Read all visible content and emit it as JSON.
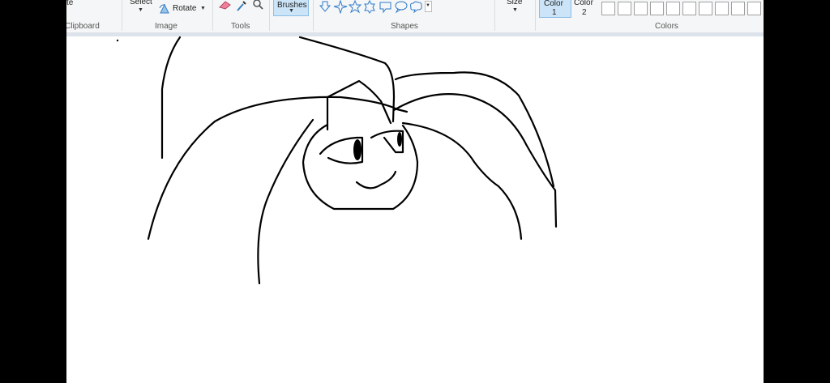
{
  "ribbon": {
    "paste_label": "te",
    "select_label": "Select",
    "rotate_label": "Rotate",
    "brushes_label": "Brushes",
    "size_label": "Size",
    "color1_label": "Color",
    "color1_num": "1",
    "color2_label": "Color",
    "color2_num": "2",
    "groups": {
      "clipboard": "Clipboard",
      "image": "Image",
      "tools": "Tools",
      "shapes": "Shapes",
      "colors": "Colors"
    }
  },
  "icons": [
    "eraser-icon",
    "color-picker-icon",
    "magnifier-icon",
    "rotate-icon",
    "arrow-down-shape-icon",
    "star-4-icon",
    "star-5-icon",
    "star-6-icon",
    "rect-callout-icon",
    "oval-callout-icon",
    "cloud-callout-icon",
    "shapes-more-icon"
  ],
  "colors": {
    "accent_bg": "#cce4f7",
    "accent_border": "#8cbde6",
    "ribbon_bg": "#f5f6f7",
    "stroke": "#000000"
  }
}
